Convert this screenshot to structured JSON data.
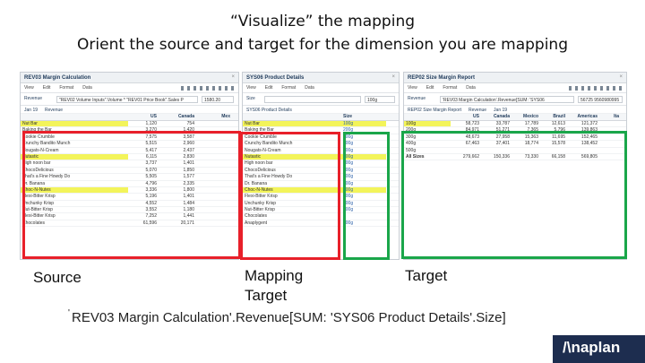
{
  "slide": {
    "title_line1": "“Visualize” the mapping",
    "title_line2": "Orient the source and target for the dimension you are mapping",
    "label_source": "Source",
    "label_mapping": "Mapping",
    "label_mapping2": "Target",
    "label_target": "Target",
    "formula_tick": "'",
    "formula": "REV03 Margin Calculation'.Revenue[SUM: 'SYS06 Product Details'.Size]",
    "logo": "/\\naplan",
    "colors": {
      "source_box": "#e8202a",
      "target_box": "#1aa64a",
      "highlight": "#f3f45a",
      "logo_bg": "#1d2d4f"
    }
  },
  "left_panel": {
    "title": "REV03 Margin Calculation",
    "close": "×",
    "toolbar": [
      "View",
      "Edit",
      "Format",
      "Data"
    ],
    "filter_label": "Revenue",
    "filter_value": "\"REV02 Volume Inputs\".Volume * \"REV01 Price Book\".Sales P",
    "filter_result": "1580.20",
    "sub_left": "Jan 19",
    "sub_right": "Revenue",
    "columns": [
      "",
      "US",
      "Canada",
      "Mex"
    ],
    "rows": [
      {
        "name": "Nut Bar",
        "us": "1,120",
        "ca": "754",
        "hl": true
      },
      {
        "name": "Baking the Bar",
        "us": "3,270",
        "ca": "1,420",
        "hl": false
      },
      {
        "name": "Cookie Crumble",
        "us": "7,575",
        "ca": "3,587",
        "hl": false
      },
      {
        "name": "Crunchy Bandito Munch",
        "us": "5,515",
        "ca": "2,960",
        "hl": false
      },
      {
        "name": "Nougats-N-Cream",
        "us": "5,417",
        "ca": "2,437",
        "hl": false
      },
      {
        "name": "Nutastic",
        "us": "6,115",
        "ca": "2,830",
        "hl": true
      },
      {
        "name": "High noon bar",
        "us": "3,737",
        "ca": "1,401",
        "hl": false
      },
      {
        "name": "ChocoDelicious",
        "us": "5,070",
        "ca": "1,850",
        "hl": false
      },
      {
        "name": "That's a Fine Howdy Do",
        "us": "5,505",
        "ca": "1,577",
        "hl": false
      },
      {
        "name": "Dr. Banana",
        "us": "4,796",
        "ca": "2,335",
        "hl": false
      },
      {
        "name": "Choc-N-Nutes",
        "us": "3,336",
        "ca": "1,800",
        "hl": true
      },
      {
        "name": "Flexi-Bitter Krisp",
        "us": "5,196",
        "ca": "1,401",
        "hl": false
      },
      {
        "name": "Unchunky Krisp",
        "us": "4,552",
        "ca": "1,484",
        "hl": false
      },
      {
        "name": "Nut-Bitter Krisp",
        "us": "3,552",
        "ca": "1,180",
        "hl": false
      },
      {
        "name": "Flexi-Bitter Krisp",
        "us": "7,252",
        "ca": "1,441",
        "hl": false
      },
      {
        "name": "Chocolates",
        "us": "61,596",
        "ca": "20,171",
        "hl": false
      }
    ]
  },
  "middle_panel": {
    "title": "SYS06 Product Details",
    "close": "×",
    "toolbar": [
      "View",
      "Edit",
      "Format",
      "Data"
    ],
    "filter_label": "Size",
    "filter_result": "100g",
    "sub_left": "SYS06 Product Details",
    "col_size": "Size",
    "rows": [
      {
        "name": "Nut Bar",
        "size": "100g",
        "hl": true
      },
      {
        "name": "Baking the Bar",
        "size": "200g",
        "hl": false
      },
      {
        "name": "Cookie Crumble",
        "size": "200g",
        "hl": false
      },
      {
        "name": "Crunchy Bandito Munch",
        "size": "400g",
        "hl": false
      },
      {
        "name": "Nougats-N-Cream",
        "size": "200g",
        "hl": false
      },
      {
        "name": "Nutastic",
        "size": "100g",
        "hl": true
      },
      {
        "name": "High noon bar",
        "size": "200g",
        "hl": false
      },
      {
        "name": "ChocoDelicious",
        "size": "400g",
        "hl": false
      },
      {
        "name": "That's a Fine Howdy Do",
        "size": "400g",
        "hl": false
      },
      {
        "name": "Dr. Banana",
        "size": "400g",
        "hl": false
      },
      {
        "name": "Choc-N-Nutes",
        "size": "100g",
        "hl": true
      },
      {
        "name": "Flexi-Bitter Krisp",
        "size": "400g",
        "hl": false
      },
      {
        "name": "Unchunky Krisp",
        "size": "200g",
        "hl": false
      },
      {
        "name": "Nut-Bitter Krisp",
        "size": "400g",
        "hl": false
      },
      {
        "name": "Chocolates",
        "size": "",
        "hl": false
      },
      {
        "name": "Anaplygent",
        "size": "200g",
        "hl": false
      }
    ]
  },
  "right_panel": {
    "title": "REP02 Size Margin Report",
    "close": "×",
    "toolbar": [
      "View",
      "Edit",
      "Format",
      "Data"
    ],
    "filter_label": "Revenue",
    "filter_value": "'REV03 Margin Calculation'.Revenue[SUM: 'SYS06",
    "filter_result": "56725 9560980995",
    "sub_left": "REP02 Size Margin Report",
    "sub_mid": "Revenue",
    "sub_right": "Jan 19",
    "columns": [
      "",
      "US",
      "Canada",
      "Mexico",
      "Brazil",
      "Americas",
      "Ita"
    ],
    "rows": [
      {
        "name": "100g",
        "v": [
          "58,723",
          "33,787",
          "17,789",
          "12,613",
          "121,372"
        ],
        "hl": true
      },
      {
        "name": "200g",
        "v": [
          "84,971",
          "51,271",
          "7,365",
          "5,796",
          "139,863"
        ],
        "hl": false
      },
      {
        "name": "300g",
        "v": [
          "48,673",
          "27,958",
          "15,363",
          "11,695",
          "152,465"
        ],
        "hl": false
      },
      {
        "name": "400g",
        "v": [
          "67,463",
          "37,401",
          "18,774",
          "15,578",
          "138,452"
        ],
        "hl": false
      },
      {
        "name": "500g",
        "v": "",
        "hl": false
      },
      {
        "name": "All Sizes",
        "v": [
          "279,662",
          "150,336",
          "73,330",
          "66,158",
          "569,805"
        ],
        "hl": false
      }
    ]
  }
}
